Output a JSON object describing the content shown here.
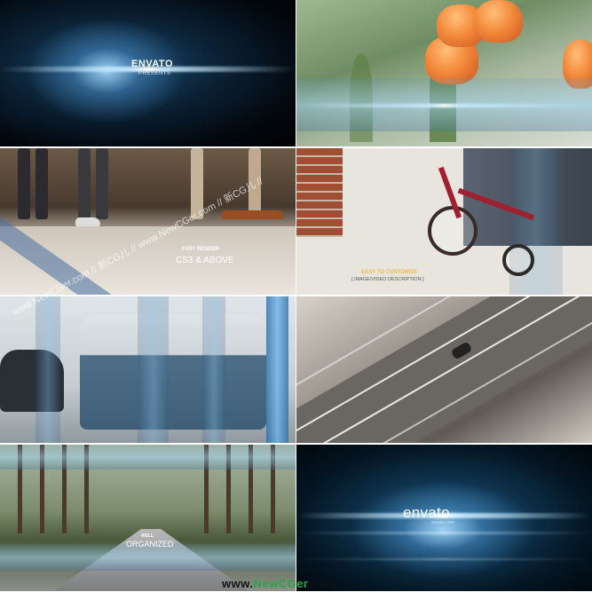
{
  "tiles": {
    "t1": {
      "brand": "ENVATO",
      "subtitle": "PRESENTS"
    },
    "t3": {
      "caption_small": "FAST RENDER",
      "caption_large": "CS3 & ABOVE"
    },
    "t4": {
      "caption_small": "EASY TO CUSTOMIZE",
      "caption_large": "[ IMAGE/VIDEO DESCRIPTION ]"
    },
    "t7": {
      "caption_small": "WELL",
      "caption_large": "ORGANIZED"
    },
    "t8": {
      "brand": "envato",
      "subtitle": "envato.com"
    }
  },
  "watermark": {
    "text": "www.NewCGer.com // 新CG儿 // www.NewCGer.com // 新CG儿 //",
    "footer_prefix": "www.",
    "footer_highlight": "NewCGer",
    "footer_suffix": ".com"
  },
  "colors": {
    "accent_blue": "#7fc4f0",
    "caption_yellow": "#f2b84a",
    "footer_green": "#2aa34a"
  }
}
